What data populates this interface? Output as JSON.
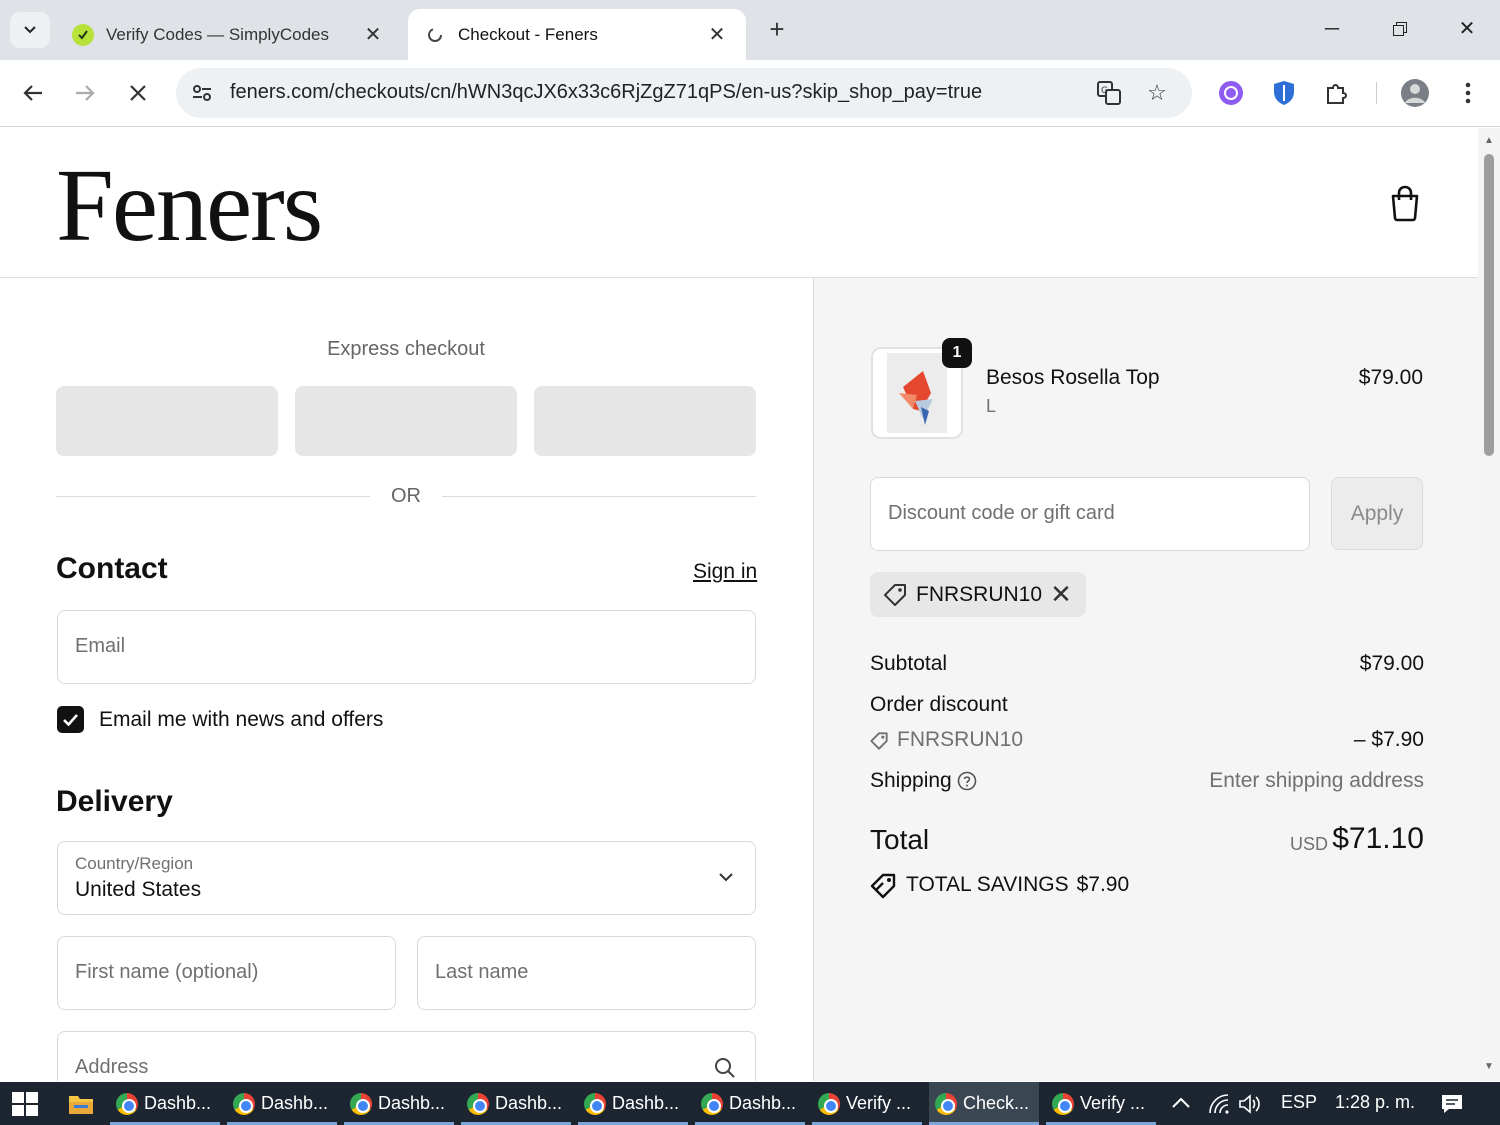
{
  "browser": {
    "tabs": [
      {
        "title": "Verify Codes — SimplyCodes",
        "active": false
      },
      {
        "title": "Checkout - Feners",
        "active": true
      }
    ],
    "url": "feners.com/checkouts/cn/hWN3qcJX6x33c6RjZgZ71qPS/en-us?skip_shop_pay=true",
    "icons": {
      "tab_search": "chevron-down-icon",
      "new_tab": "plus-icon",
      "minimize": "minimize-icon",
      "restore": "restore-icon",
      "close": "close-icon",
      "back": "back-arrow-icon",
      "forward": "forward-arrow-icon",
      "stop": "stop-loading-icon",
      "site_info": "site-settings-icon",
      "translate": "translate-icon",
      "bookmark": "star-icon",
      "extensions": "puzzle-icon",
      "menu": "kebab-menu-icon"
    }
  },
  "store": {
    "logo": "Feners"
  },
  "checkout": {
    "express_title": "Express checkout",
    "or_text": "OR",
    "contact": {
      "heading": "Contact",
      "sign_in": "Sign in",
      "email_placeholder": "Email",
      "news_label": "Email me with news and offers",
      "news_checked": true
    },
    "delivery": {
      "heading": "Delivery",
      "country_label": "Country/Region",
      "country_value": "United States",
      "first_name_placeholder": "First name (optional)",
      "last_name_placeholder": "Last name",
      "address_placeholder": "Address"
    }
  },
  "summary": {
    "product": {
      "name": "Besos Rosella Top",
      "variant": "L",
      "price": "$79.00",
      "quantity": "1"
    },
    "discount_placeholder": "Discount code or gift card",
    "apply_label": "Apply",
    "applied_code": "FNRSRUN10",
    "subtotal_label": "Subtotal",
    "subtotal_value": "$79.00",
    "order_discount_label": "Order discount",
    "discount_code": "FNRSRUN10",
    "discount_value": "– $7.90",
    "shipping_label": "Shipping",
    "shipping_value": "Enter shipping address",
    "total_label": "Total",
    "total_currency": "USD",
    "total_value": "$71.10",
    "savings_label": "TOTAL SAVINGS",
    "savings_value": "$7.90"
  },
  "taskbar": {
    "apps": [
      {
        "label": "Dashb...",
        "active": false
      },
      {
        "label": "Dashb...",
        "active": false
      },
      {
        "label": "Dashb...",
        "active": false
      },
      {
        "label": "Dashb...",
        "active": false
      },
      {
        "label": "Dashb...",
        "active": false
      },
      {
        "label": "Dashb...",
        "active": false
      },
      {
        "label": "Verify ...",
        "active": false
      },
      {
        "label": "Check...",
        "active": true
      },
      {
        "label": "Verify ...",
        "active": false
      }
    ],
    "language": "ESP",
    "time": "1:28 p. m."
  },
  "colors": {
    "accent": "#111111",
    "panel": "#f5f5f5",
    "taskbar": "#1c2530"
  }
}
